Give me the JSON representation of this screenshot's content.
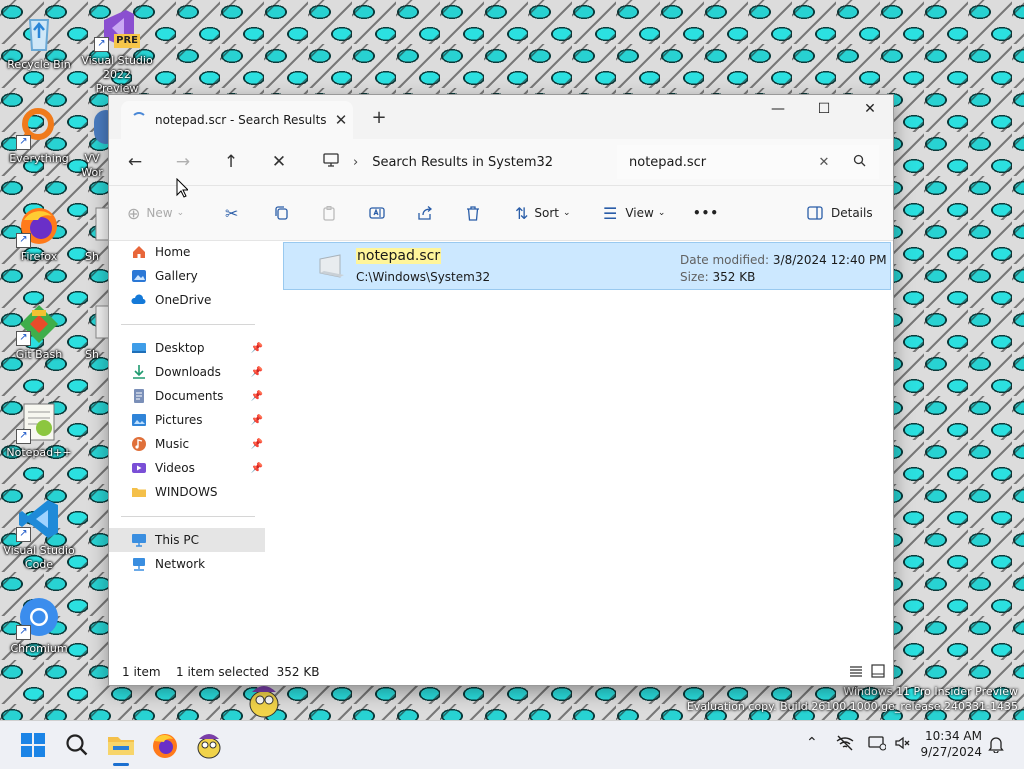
{
  "desktop": {
    "icons": [
      {
        "label": "Recycle Bin"
      },
      {
        "label": "Visual Studio 2022 Preview",
        "badge": "PRE"
      },
      {
        "label": "Everything"
      },
      {
        "label": "VV Wor"
      },
      {
        "label": "Firefox"
      },
      {
        "label": "Sh"
      },
      {
        "label": "Git Bash"
      },
      {
        "label": "Sh"
      },
      {
        "label": "Notepad++"
      },
      {
        "label": "Visual Studio Code"
      },
      {
        "label": "Chromium"
      }
    ],
    "watermark": {
      "line1": "Windows 11 Pro Insider Preview",
      "line2": "Evaluation copy. Build 26100.1000.ge_release.240331-1435"
    }
  },
  "window": {
    "tab_title": "notepad.scr - Search Results in",
    "controls": {
      "minimize": "—",
      "maximize": "☐",
      "close": "✕"
    },
    "address": {
      "location": "Search Results in System32"
    },
    "search": {
      "value": "notepad.scr"
    },
    "commands": {
      "new": "New",
      "sort": "Sort",
      "view": "View",
      "more": "•••",
      "details": "Details"
    },
    "sidebar": {
      "group1": [
        {
          "label": "Home",
          "icon": "home-icon",
          "color": "#e8663a"
        },
        {
          "label": "Gallery",
          "icon": "gallery-icon",
          "color": "#2b78d6"
        },
        {
          "label": "OneDrive",
          "icon": "cloud-icon",
          "color": "#1479d8"
        }
      ],
      "group2": [
        {
          "label": "Desktop",
          "icon": "desktop-folder-icon",
          "color": "#3f9de8",
          "pinned": true
        },
        {
          "label": "Downloads",
          "icon": "download-icon",
          "color": "#1f9a6f",
          "pinned": true
        },
        {
          "label": "Documents",
          "icon": "documents-icon",
          "color": "#7a8fb8",
          "pinned": true
        },
        {
          "label": "Pictures",
          "icon": "pictures-icon",
          "color": "#2f84d8",
          "pinned": true
        },
        {
          "label": "Music",
          "icon": "music-icon",
          "color": "#e0703a",
          "pinned": true
        },
        {
          "label": "Videos",
          "icon": "videos-icon",
          "color": "#7a4fd6",
          "pinned": true
        },
        {
          "label": "WINDOWS",
          "icon": "folder-icon",
          "color": "#f4c04a",
          "pinned": false
        }
      ],
      "group3": [
        {
          "label": "This PC",
          "icon": "pc-icon",
          "color": "#3a8ee0",
          "selected": true
        },
        {
          "label": "Network",
          "icon": "network-icon",
          "color": "#3a8ee0"
        }
      ]
    },
    "results": [
      {
        "name": "notepad.scr",
        "path": "C:\\Windows\\System32",
        "date_label": "Date modified:",
        "date_value": "3/8/2024 12:40 PM",
        "size_label": "Size:",
        "size_value": "352 KB"
      }
    ],
    "status": {
      "count": "1 item",
      "selection": "1 item selected  352 KB"
    }
  },
  "taskbar": {
    "clock": {
      "time": "10:34 AM",
      "date": "9/27/2024"
    }
  }
}
